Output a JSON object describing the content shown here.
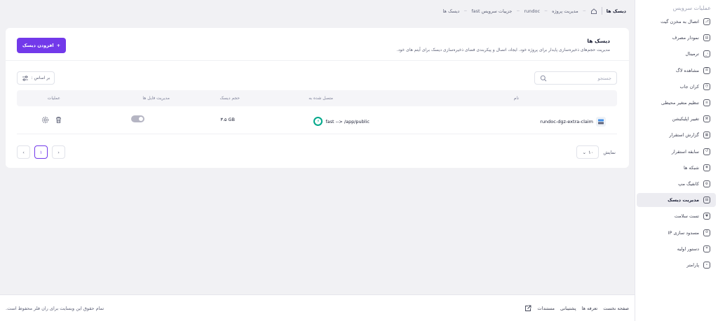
{
  "sidebar": {
    "title": "عملیات سرویس",
    "items": [
      {
        "label": "اتصال به مخزن گیت",
        "icon": "git-icon",
        "active": false
      },
      {
        "label": "نمودار مصرف",
        "icon": "chart-icon",
        "active": false
      },
      {
        "label": "ترمینال",
        "icon": "terminal-icon",
        "active": false
      },
      {
        "label": "مشاهده لاگ",
        "icon": "log-icon",
        "active": false
      },
      {
        "label": "کران جاب",
        "icon": "cron-icon",
        "active": false
      },
      {
        "label": "تنظیم متغیر محیطی",
        "icon": "env-icon",
        "active": false
      },
      {
        "label": "تغییر اپلیکیشن",
        "icon": "apps-icon",
        "active": false
      },
      {
        "label": "گزارش استقرار",
        "icon": "report-icon",
        "active": false
      },
      {
        "label": "سابقه استقرار",
        "icon": "history-icon",
        "active": false
      },
      {
        "label": "شبکه ها",
        "icon": "network-icon",
        "active": false
      },
      {
        "label": "کانفیگ مپ",
        "icon": "config-icon",
        "active": false
      },
      {
        "label": "مدیریت دیسک",
        "icon": "disk-icon",
        "active": true
      },
      {
        "label": "تست سلامت",
        "icon": "health-icon",
        "active": false
      },
      {
        "label": "مسدود سازی IP",
        "icon": "block-icon",
        "active": false
      },
      {
        "label": "دستور اولیه",
        "icon": "command-icon",
        "active": false
      },
      {
        "label": "پارامتر",
        "icon": "param-icon",
        "active": false
      }
    ]
  },
  "breadcrumb": {
    "current": "دیسک ها",
    "items": [
      "مدیریت پروژه",
      "rundoc",
      "جزییات سرویس fast",
      "دیسک ها"
    ]
  },
  "card": {
    "title": "دیسک ها",
    "description": "مدیریت حجم‌های ذخیره‌سازی پایدار برای پروژه خود. ایجاد، اتصال و پیکربندی فضای ذخیره‌سازی دیسک برای آیتم های خود.",
    "add_button": "افزودن دیسک"
  },
  "toolbar": {
    "search_placeholder": "جستجو",
    "sort_label": "بر اساس :"
  },
  "table": {
    "headers": {
      "name": "نام",
      "attached": "متصل شده به",
      "size": "حجم دیسک",
      "file_manager": "مدیریت فایل ها",
      "actions": "عملیات"
    },
    "rows": [
      {
        "name": "rundoc-dgz-extra-claim",
        "attached": "fast --> /app/public",
        "size": "۳.۵ GB",
        "file_manager_enabled": false
      }
    ]
  },
  "pagination": {
    "show_label": "نمایش",
    "per_page": "۱۰",
    "current_page": "۱"
  },
  "footer": {
    "links": [
      "صفحه نخست",
      "تعرفه ها",
      "پشتیبانی",
      "مستندات"
    ],
    "copyright": "تمام حقوق این وبسایت برای ران فلر محفوظ است."
  },
  "colors": {
    "accent": "#7239ea",
    "service_green": "#00a88a"
  }
}
